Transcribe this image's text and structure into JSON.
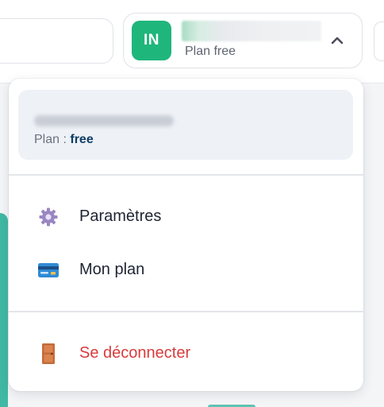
{
  "header": {
    "account": {
      "avatar_initials": "IN",
      "plan_text": "Plan free",
      "expanded": true
    }
  },
  "dropdown": {
    "plan_prefix": "Plan : ",
    "plan_value": "free",
    "items": [
      {
        "label": "Paramètres",
        "icon": "gear-icon"
      },
      {
        "label": "Mon plan",
        "icon": "credit-card-icon"
      },
      {
        "label": "Se déconnecter",
        "icon": "door-icon",
        "danger": true
      }
    ]
  },
  "colors": {
    "avatar_bg": "#1fb67c",
    "plan_value": "#0f3d64",
    "danger": "#d93b3b",
    "teal_accent": "#3fb9a3"
  }
}
